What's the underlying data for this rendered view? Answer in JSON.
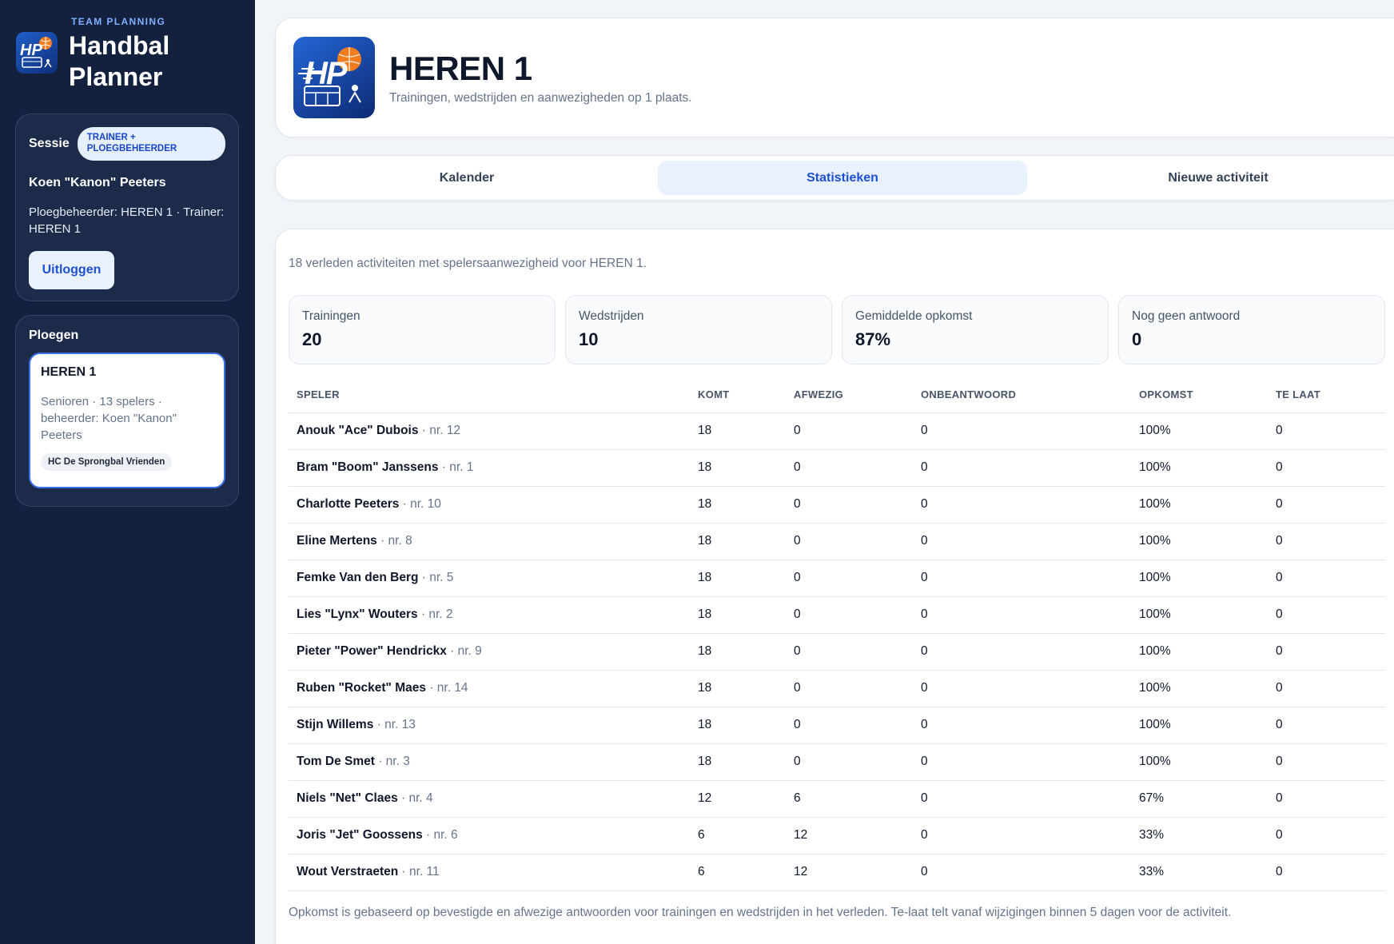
{
  "sidebar": {
    "eyebrow": "TEAM PLANNING",
    "title_line1": "Handbal",
    "title_line2": "Planner",
    "logo_text": "HP",
    "session": {
      "label": "Sessie",
      "role": "TRAINER + PLOEGBEHEERDER",
      "user": "Koen \"Kanon\" Peeters",
      "roles_text": "Ploegbeheerder: HEREN 1 · Trainer: HEREN 1",
      "logout_label": "Uitloggen"
    },
    "teams": {
      "label": "Ploegen",
      "items": [
        {
          "name": "HEREN 1",
          "description": "Senioren · 13 spelers · beheerder: Koen \"Kanon\" Peeters",
          "club": "HC De Sprongbal Vrienden"
        }
      ]
    }
  },
  "header": {
    "title": "HEREN 1",
    "subtitle": "Trainingen, wedstrijden en aanwezigheden op 1 plaats.",
    "logo_text": "HP"
  },
  "tabs": [
    {
      "label": "Kalender",
      "active": false
    },
    {
      "label": "Statistieken",
      "active": true
    },
    {
      "label": "Nieuwe activiteit",
      "active": false
    }
  ],
  "stats": {
    "intro": "18 verleden activiteiten met spelersaanwezigheid voor HEREN 1.",
    "kpis": [
      {
        "label": "Trainingen",
        "value": "20"
      },
      {
        "label": "Wedstrijden",
        "value": "10"
      },
      {
        "label": "Gemiddelde opkomst",
        "value": "87%"
      },
      {
        "label": "Nog geen antwoord",
        "value": "0"
      }
    ],
    "columns": [
      "SPELER",
      "KOMT",
      "AFWEZIG",
      "ONBEANTWOORD",
      "OPKOMST",
      "TE LAAT"
    ],
    "rows": [
      {
        "name": "Anouk \"Ace\" Dubois",
        "nr": " · nr. 12",
        "komt": "18",
        "afwezig": "0",
        "onbeantwoord": "0",
        "opkomst": "100%",
        "te_laat": "0"
      },
      {
        "name": "Bram \"Boom\" Janssens",
        "nr": " · nr. 1",
        "komt": "18",
        "afwezig": "0",
        "onbeantwoord": "0",
        "opkomst": "100%",
        "te_laat": "0"
      },
      {
        "name": "Charlotte Peeters",
        "nr": " · nr. 10",
        "komt": "18",
        "afwezig": "0",
        "onbeantwoord": "0",
        "opkomst": "100%",
        "te_laat": "0"
      },
      {
        "name": "Eline Mertens",
        "nr": " · nr. 8",
        "komt": "18",
        "afwezig": "0",
        "onbeantwoord": "0",
        "opkomst": "100%",
        "te_laat": "0"
      },
      {
        "name": "Femke Van den Berg",
        "nr": " · nr. 5",
        "komt": "18",
        "afwezig": "0",
        "onbeantwoord": "0",
        "opkomst": "100%",
        "te_laat": "0"
      },
      {
        "name": "Lies \"Lynx\" Wouters",
        "nr": " · nr. 2",
        "komt": "18",
        "afwezig": "0",
        "onbeantwoord": "0",
        "opkomst": "100%",
        "te_laat": "0"
      },
      {
        "name": "Pieter \"Power\" Hendrickx",
        "nr": " · nr. 9",
        "komt": "18",
        "afwezig": "0",
        "onbeantwoord": "0",
        "opkomst": "100%",
        "te_laat": "0"
      },
      {
        "name": "Ruben \"Rocket\" Maes",
        "nr": " · nr. 14",
        "komt": "18",
        "afwezig": "0",
        "onbeantwoord": "0",
        "opkomst": "100%",
        "te_laat": "0"
      },
      {
        "name": "Stijn Willems",
        "nr": " · nr. 13",
        "komt": "18",
        "afwezig": "0",
        "onbeantwoord": "0",
        "opkomst": "100%",
        "te_laat": "0"
      },
      {
        "name": "Tom De Smet",
        "nr": " · nr. 3",
        "komt": "18",
        "afwezig": "0",
        "onbeantwoord": "0",
        "opkomst": "100%",
        "te_laat": "0"
      },
      {
        "name": "Niels \"Net\" Claes",
        "nr": " · nr. 4",
        "komt": "12",
        "afwezig": "6",
        "onbeantwoord": "0",
        "opkomst": "67%",
        "te_laat": "0"
      },
      {
        "name": "Joris \"Jet\" Goossens",
        "nr": " · nr. 6",
        "komt": "6",
        "afwezig": "12",
        "onbeantwoord": "0",
        "opkomst": "33%",
        "te_laat": "0"
      },
      {
        "name": "Wout Verstraeten",
        "nr": " · nr. 11",
        "komt": "6",
        "afwezig": "12",
        "onbeantwoord": "0",
        "opkomst": "33%",
        "te_laat": "0"
      }
    ],
    "footnote": "Opkomst is gebaseerd op bevestigde en afwezige antwoorden voor trainingen en wedstrijden in het verleden. Te-laat telt vanaf wijzigingen binnen 5 dagen voor de activiteit."
  },
  "colors": {
    "sidebar_bg": "#13213f",
    "accent": "#1d4ed8",
    "ball_orange": "#f07c1e"
  }
}
